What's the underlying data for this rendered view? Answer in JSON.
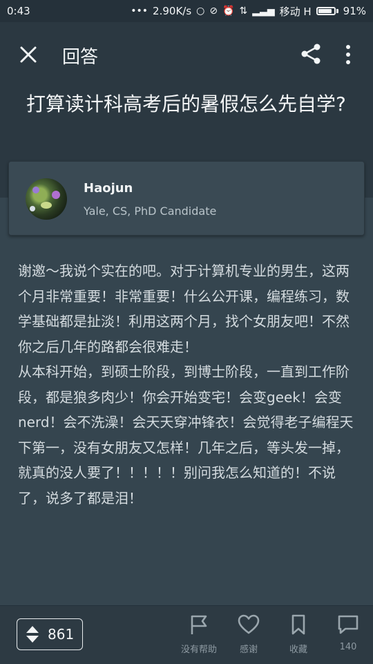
{
  "status_bar": {
    "time": "0:43",
    "network_speed": "2.90K/s",
    "carrier": "移动 H",
    "battery": "91%",
    "battery_level": 0.91
  },
  "app_bar": {
    "title": "回答",
    "close_icon": "close-icon",
    "share_icon": "share-icon",
    "more_icon": "more-vertical-icon"
  },
  "question": {
    "title": "打算读计科高考后的暑假怎么先自学?"
  },
  "author": {
    "name": "Haojun",
    "bio": "Yale, CS, PhD Candidate"
  },
  "answer": {
    "paragraphs": [
      "谢邀～我说个实在的吧。对于计算机专业的男生，这两个月非常重要！非常重要！什么公开课，编程练习，数学基础都是扯淡！利用这两个月，找个女朋友吧！不然你之后几年的路都会很难走！",
      "从本科开始，到硕士阶段，到博士阶段，一直到工作阶段，都是狼多肉少！你会开始变宅！会变geek！会变nerd！会不洗澡！会天天穿冲锋衣！会觉得老子编程天下第一，没有女朋友又怎样！几年之后，等头发一掉，就真的没人要了！！！！！别问我怎么知道的！不说了，说多了都是泪！"
    ]
  },
  "bottom_bar": {
    "vote_count": "861",
    "actions": {
      "no_help": "没有帮助",
      "thanks": "感谢",
      "collect": "收藏",
      "comments": "140"
    }
  },
  "colors": {
    "background": "#35454f",
    "header": "#2b3841",
    "status_bar": "#25313a",
    "card": "#3a4a54",
    "text": "#d4dbdf"
  }
}
